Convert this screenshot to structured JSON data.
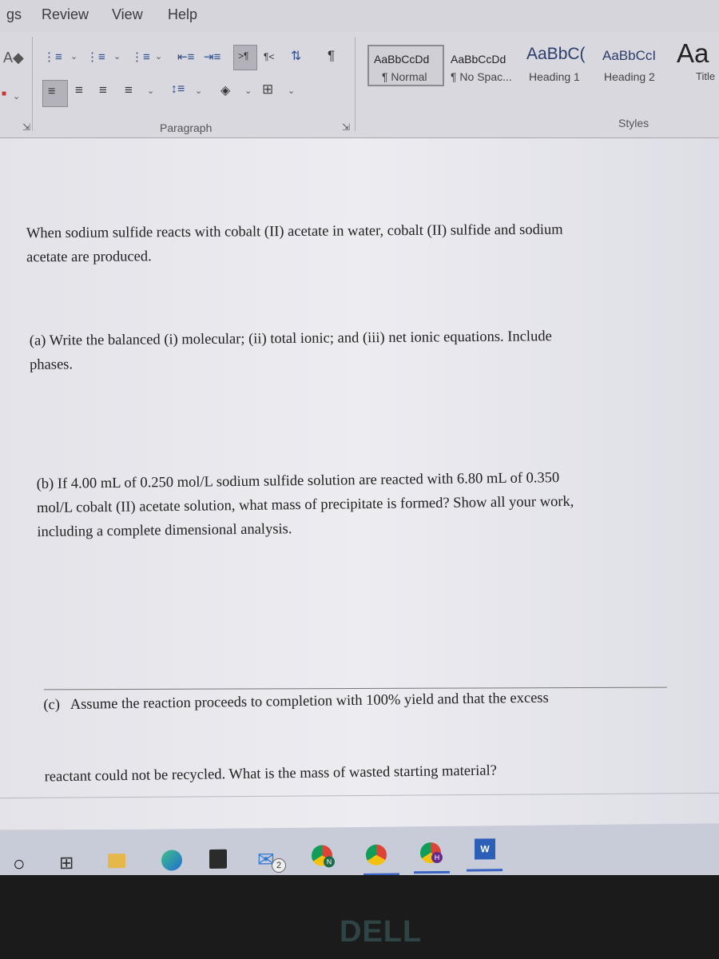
{
  "ribbon": {
    "tabs": [
      "gs",
      "Review",
      "View",
      "Help"
    ],
    "paragraph_group": {
      "label": "Paragraph",
      "row1": [
        "bullets",
        "numbering",
        "multilevel-list",
        "decrease-indent",
        "increase-indent",
        "ltr-text-direction",
        "rtl-text-direction",
        "sort",
        "show-formatting-marks"
      ],
      "row2": [
        "align-left",
        "center",
        "align-right",
        "justify",
        "line-spacing",
        "shading",
        "borders"
      ]
    },
    "styles_group": {
      "label": "Styles",
      "items": [
        {
          "sample": "AaBbCcDd",
          "name": "¶ Normal",
          "selected": true
        },
        {
          "sample": "AaBbCcDd",
          "name": "¶ No Spac...",
          "selected": false
        },
        {
          "sample": "AaBbC(",
          "name": "Heading 1",
          "selected": false
        },
        {
          "sample": "AaBbCcI",
          "name": "Heading 2",
          "selected": false
        },
        {
          "sample": "Aa",
          "name": "Title",
          "selected": false
        }
      ]
    }
  },
  "document": {
    "intro": [
      "When sodium sulfide reacts with cobalt (II) acetate in water, cobalt (II) sulfide and sodium",
      "acetate are produced."
    ],
    "part_a": [
      "(a) Write the balanced (i) molecular; (ii) total ionic; and (iii) net ionic equations. Include",
      "phases."
    ],
    "part_b": [
      "(b) If 4.00 mL of 0.250 mol/L sodium sulfide solution are reacted with 6.80 mL of 0.350",
      "mol/L cobalt (II) acetate solution, what mass of precipitate is formed? Show all your work,",
      "including a complete dimensional analysis."
    ],
    "part_c": [
      "(c)   Assume the reaction proceeds to completion with 100% yield and that the excess",
      "reactant could not be recycled. What is the mass of wasted starting material?"
    ]
  },
  "taskbar": {
    "items": [
      {
        "name": "cortana-search",
        "glyph": "O"
      },
      {
        "name": "task-view",
        "glyph": "□"
      },
      {
        "name": "file-explorer",
        "glyph": ""
      },
      {
        "name": "edge",
        "glyph": "e"
      },
      {
        "name": "microsoft-store",
        "glyph": ""
      },
      {
        "name": "mail",
        "glyph": "✉",
        "badge": "2"
      },
      {
        "name": "chrome-profile-n",
        "badge": "N"
      },
      {
        "name": "chrome",
        "badge": ""
      },
      {
        "name": "chrome-profile-h",
        "badge": "H"
      },
      {
        "name": "word",
        "glyph": "W"
      }
    ]
  },
  "bezel": {
    "brand": "DELL"
  },
  "colors": {
    "accent": "#3b63c2",
    "doc_bg": "#ebebf0",
    "ribbon_bg": "#d9d8df"
  }
}
